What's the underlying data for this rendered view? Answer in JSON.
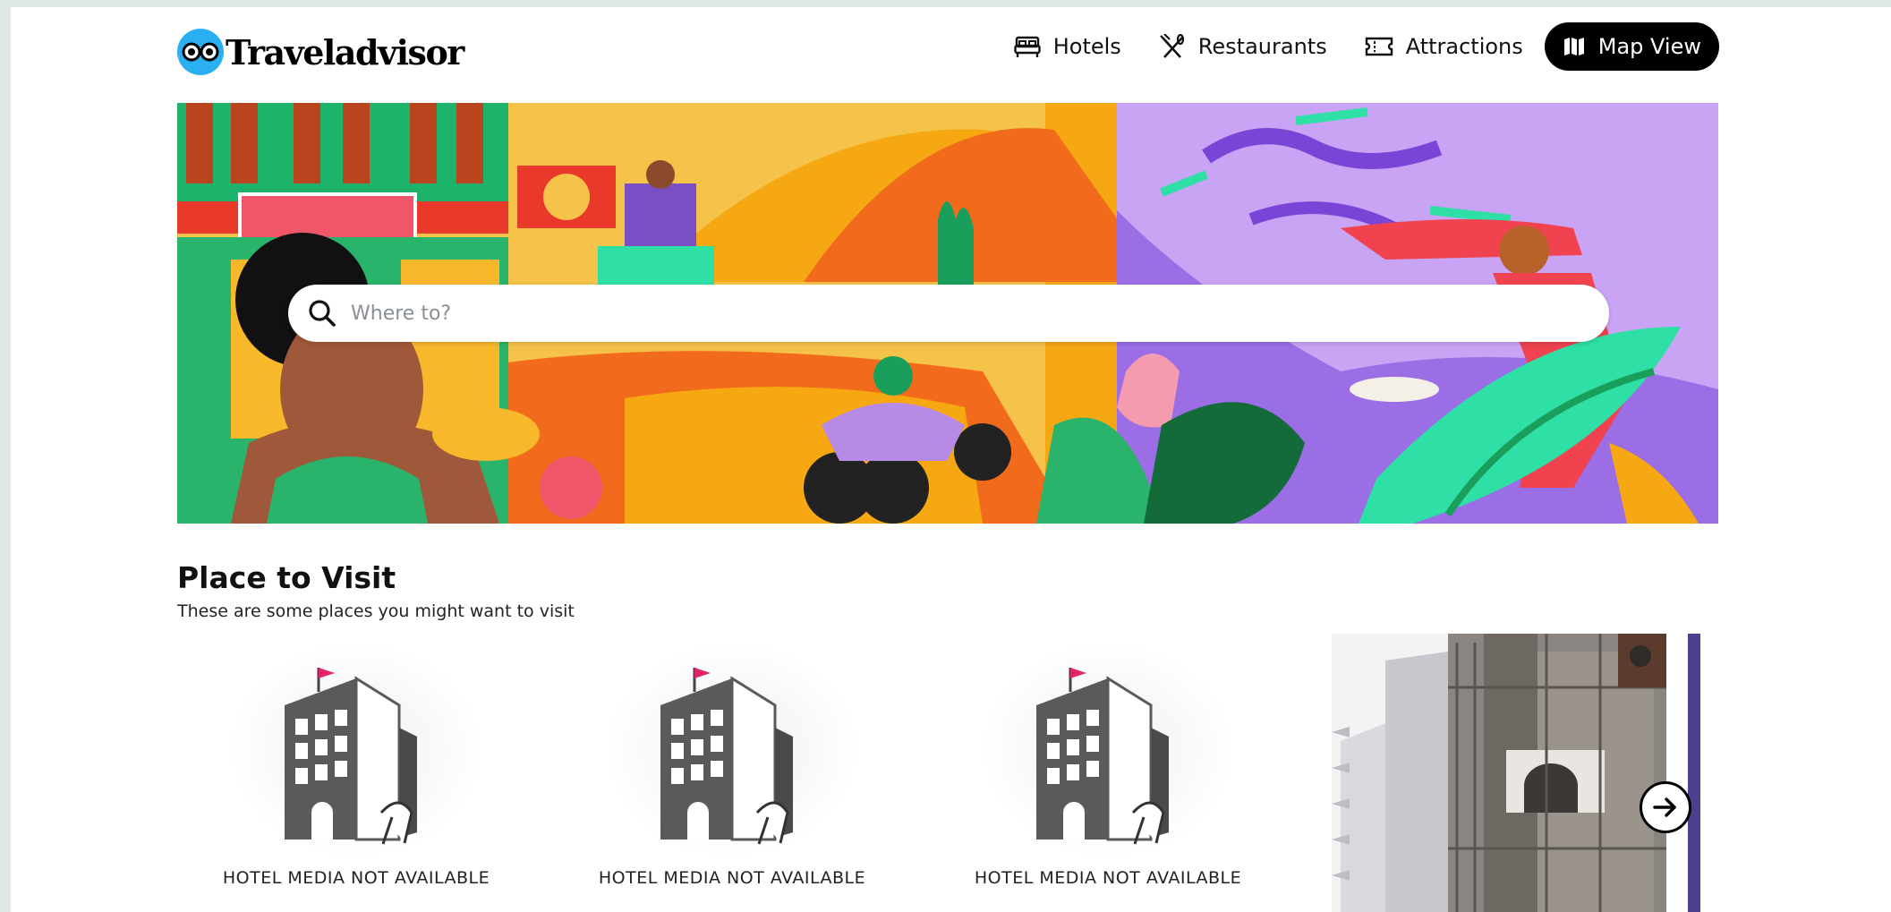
{
  "header": {
    "logo_text": "Traveladvisor",
    "nav": [
      {
        "label": "Hotels",
        "icon": "bed-icon"
      },
      {
        "label": "Restaurants",
        "icon": "utensils-icon"
      },
      {
        "label": "Attractions",
        "icon": "ticket-icon"
      }
    ],
    "map_view_label": "Map View",
    "map_view_icon": "map-icon"
  },
  "hero": {
    "search_placeholder": "Where to?",
    "search_icon": "search-icon"
  },
  "section": {
    "title": "Place to Visit",
    "subtitle": "These are some places you might want to visit"
  },
  "cards": [
    {
      "caption": "HOTEL MEDIA NOT AVAILABLE"
    },
    {
      "caption": "HOTEL MEDIA NOT AVAILABLE"
    },
    {
      "caption": "HOTEL MEDIA NOT AVAILABLE"
    }
  ],
  "next_icon": "arrow-right-icon",
  "colors": {
    "logo_blue": "#2ab0f0",
    "accent_black": "#000000",
    "page_border": "#dfe8e6"
  }
}
